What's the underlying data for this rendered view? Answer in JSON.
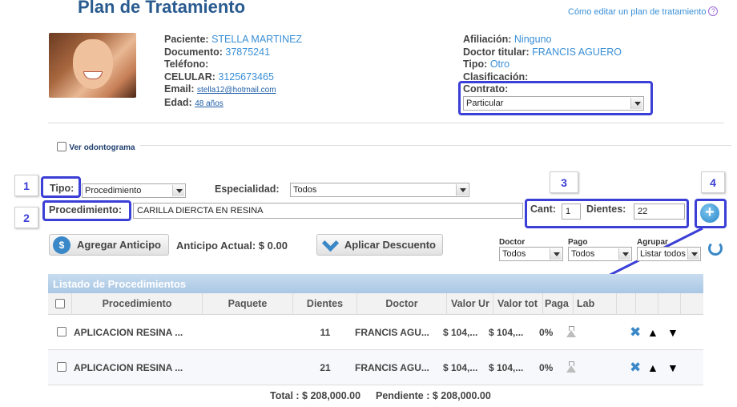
{
  "header": {
    "title": "Plan de Tratamiento",
    "help_link": "Cómo editar un plan de tratamiento",
    "help_icon": "question-circle-icon"
  },
  "patient": {
    "avatar_alt": "",
    "fields": [
      {
        "label": "Paciente:",
        "value": "STELLA MARTINEZ"
      },
      {
        "label": "Documento:",
        "value": "37875241"
      },
      {
        "label": "Teléfono:",
        "value": ""
      },
      {
        "label": "CELULAR:",
        "value": "3125673465"
      },
      {
        "label": "Email:",
        "value": "stella12@hotmail.com"
      },
      {
        "label": "Edad:",
        "value": "48 años"
      }
    ],
    "right_fields": [
      {
        "label": "Afiliación:",
        "value": "Ninguno"
      },
      {
        "label": "Doctor titular:",
        "value": "FRANCIS AGUERO"
      },
      {
        "label": "Tipo:",
        "value": "Otro"
      },
      {
        "label": "Clasificación:",
        "value": ""
      }
    ],
    "contrato_label": "Contrato:",
    "contrato_value": "Particular"
  },
  "odontograma": {
    "label": "Ver odontograma"
  },
  "annotations": {
    "n1": "1",
    "n2": "2",
    "n3": "3",
    "n4": "4",
    "accent": "#3b3fd6"
  },
  "form": {
    "tipo_label": "Tipo:",
    "tipo_value": "Procedimiento",
    "especialidad_label": "Especialidad:",
    "especialidad_value": "Todos",
    "procedimiento_label": "Procedimiento:",
    "procedimiento_value": "CARILLA DIERCTA EN RESINA",
    "cant_label": "Cant:",
    "cant_value": "1",
    "dientes_label": "Dientes:",
    "dientes_value": "22"
  },
  "actions": {
    "anticipo_button": "Agregar Anticipo",
    "anticipo_actual": "Anticipo Actual: $ 0.00",
    "descuento_button": "Aplicar Descuento"
  },
  "filters": {
    "doctor_label": "Doctor",
    "doctor_value": "Todos",
    "pago_label": "Pago",
    "pago_value": "Todos",
    "agrupar_label": "Agrupar",
    "agrupar_value": "Listar todos"
  },
  "table": {
    "title": "Listado de Procedimientos",
    "columns": [
      "Procedimiento",
      "Paquete",
      "Dientes",
      "Doctor",
      "Valor Ur",
      "Valor tot",
      "Paga",
      "Lab"
    ],
    "rows": [
      {
        "procedimiento": "APLICACION RESINA ...",
        "paquete": "",
        "dientes": "11",
        "doctor": "FRANCIS AGU...",
        "valor_unit": "$ 104,...",
        "valor_total": "$ 104,...",
        "pagado": "0%"
      },
      {
        "procedimiento": "APLICACION RESINA ...",
        "paquete": "",
        "dientes": "21",
        "doctor": "FRANCIS AGU...",
        "valor_unit": "$ 104,...",
        "valor_total": "$ 104,...",
        "pagado": "0%"
      }
    ]
  },
  "totals": {
    "total": "Total : $ 208,000.00",
    "pendiente": "Pendiente : $ 208,000.00"
  }
}
